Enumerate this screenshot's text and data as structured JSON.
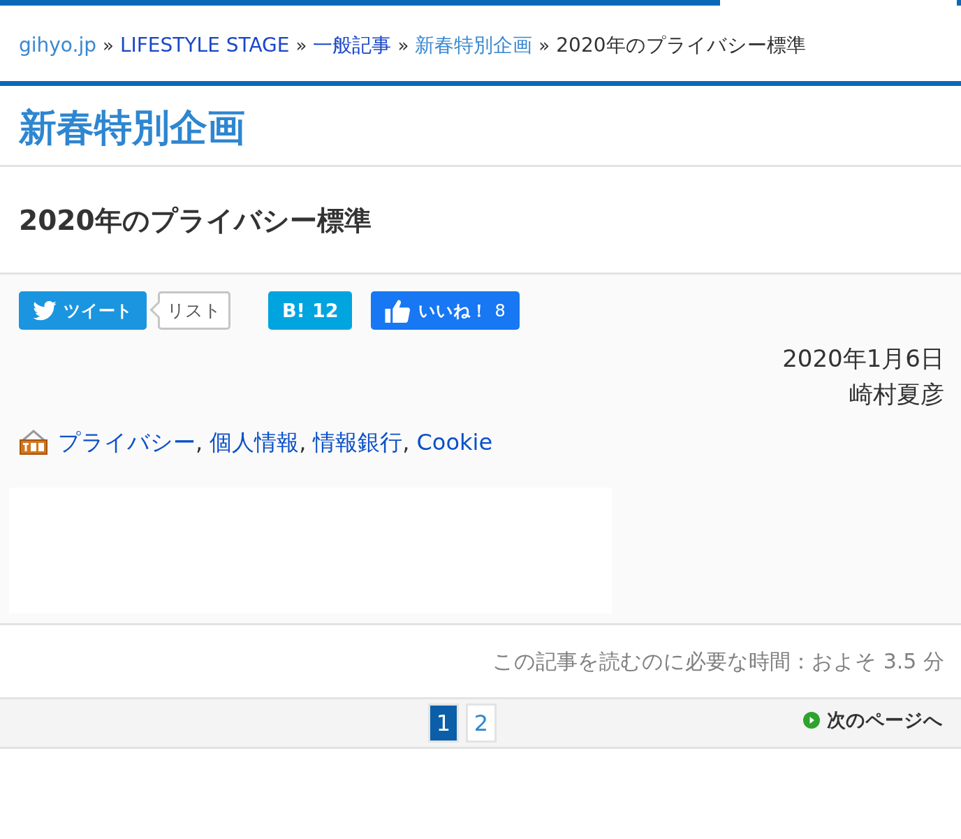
{
  "breadcrumb": [
    {
      "label": "gihyo.jp",
      "color": "#3a88d0"
    },
    {
      "label": "LIFESTYLE STAGE",
      "color": "#1a47c8"
    },
    {
      "label": "一般記事",
      "color": "#1a47c8"
    },
    {
      "label": "新春特別企画",
      "color": "#3a88d0"
    },
    {
      "label": "2020年のプライバシー標準",
      "color": "#333333"
    }
  ],
  "breadcrumb_separator": "»",
  "series_title": "新春特別企画",
  "article_title": "2020年のプライバシー標準",
  "share": {
    "tweet": "ツイート",
    "list": "リスト",
    "hatena_label": "B!",
    "hatena_count": "12",
    "like_label": "いいね！",
    "like_count": "8"
  },
  "date": "2020年1月6日",
  "author": "崎村夏彦",
  "tags": [
    {
      "label": "プライバシー"
    },
    {
      "label": "個人情報"
    },
    {
      "label": "情報銀行"
    },
    {
      "label": "Cookie"
    }
  ],
  "tag_separator": ",",
  "reading_time": "この記事を読むのに必要な時間：およそ 3.5 分",
  "pages": [
    {
      "label": "1",
      "selected": true
    },
    {
      "label": "2",
      "selected": false
    }
  ],
  "next_page": "次のページへ"
}
